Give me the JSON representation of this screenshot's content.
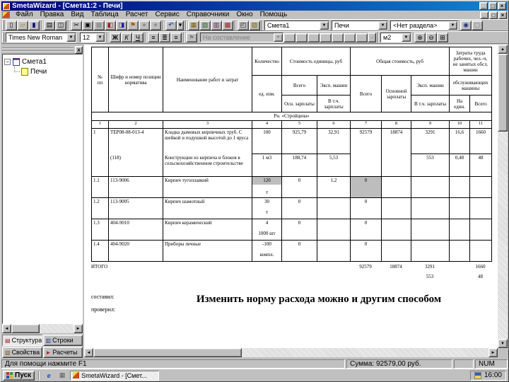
{
  "window": {
    "title": "SmetaWizard - [Смета1:2 - Печи]",
    "minimize": "_",
    "maximize": "□",
    "close": "×"
  },
  "menu": {
    "items": [
      "Файл",
      "Правка",
      "Вид",
      "Таблица",
      "Расчет",
      "Сервис",
      "Справочники",
      "Окно",
      "Помощь"
    ]
  },
  "icons": {
    "new": "▯",
    "open": "▱",
    "save": "▮",
    "print": "▤",
    "preview": "◫",
    "cut": "✂",
    "copy": "▣",
    "paste": "▩",
    "insert": "◧",
    "paste_special": "◨",
    "flag": "⚑",
    "wizard": "∗",
    "magic": "∗",
    "undo": "↶",
    "dropdown": "▾",
    "table": "▦",
    "edit_table": "▧",
    "add_table": "▥",
    "grid": "▩",
    "cell": "▨",
    "properties": "◰",
    "window": "▢",
    "find": "◉",
    "bold": "Ж",
    "italic": "К",
    "underline": "Ч",
    "align_left": "≡",
    "align_center": "≣",
    "align_right": "≡",
    "zoom_in": "⊕",
    "zoom_out": "⊖",
    "zoom_page": "⊞",
    "up": "▲",
    "down": "▼",
    "left": "◄",
    "right": "►",
    "minus": "−",
    "more": "▫",
    "ie": "e",
    "desktop": "▦",
    "tab_structure": "▤",
    "tab_rows": "▥",
    "tab_props": "▧",
    "tab_calc": "►"
  },
  "toolbar1": {
    "smeta_combo": "Смета1",
    "doc_combo": "Печи",
    "razdel_combo": "<Нет раздела>"
  },
  "toolbar2": {
    "font": "Times New Roman",
    "font_size": "12",
    "formula_combo": "На составление",
    "unit_combo": "м2"
  },
  "sidebar": {
    "root": "Смета1",
    "child": "Печи",
    "close": "x",
    "tabs": [
      "Структура",
      "Строки",
      "Свойства",
      "Расчеты"
    ]
  },
  "statusbar": {
    "help": "Для помощи нажмите F1",
    "sum": "Сумма: 92579,00 руб.",
    "num": "NUM"
  },
  "taskbar": {
    "start": "Пуск",
    "task": "SmetaWizard - [Смет...",
    "clock": "16:00"
  },
  "document": {
    "section_title": "Рн. «Стройцена»",
    "header": {
      "c1": "№\nпп",
      "c2": "Шифр и номер позиции норматива",
      "c3": "Наименование работ и затрат",
      "c4": "Количество",
      "c4_sub": "ед. изм.",
      "g_unit_cost": "Стоимость единицы, руб",
      "g_total_cost": "Общая стоимость, руб",
      "g_labor": "Затраты труда рабочих, чел.-ч, не занятых обсл. машин",
      "b5": "Всего",
      "b6": "Эксп. машин",
      "b7": "Всего",
      "b8": "Основной зарплаты",
      "b9": "Эксп. машин",
      "b_serv": "обслуживающих машины",
      "s5": "Осн. зарплаты",
      "s6": "В т.ч. зарплаты",
      "s9": "В т.ч. зарплаты",
      "s10": "На един.",
      "s11": "Всего",
      "numbers": [
        "1",
        "2",
        "3",
        "4",
        "5",
        "6",
        "7",
        "8",
        "9",
        "10",
        "11"
      ]
    },
    "rows": [
      {
        "num": "1",
        "code": "ТЕР08-08-013-4",
        "name": "Кладка дымовых кирпичных труб. С шейкой и подушкой высотой до 1 яруса",
        "qty": "100",
        "unit": "",
        "v5": "925,79",
        "v6": "32,91",
        "v7": "92579",
        "v8": "18874",
        "v9": "3291",
        "v10": "16,6",
        "v11": "1660",
        "style": "main"
      },
      {
        "num": "",
        "code": "(118)",
        "name": "Конструкции из кирпича и блоков в сельскохозяйственном строительстве",
        "qty": "1 м3",
        "unit": "",
        "v5": "188,74",
        "v6": "5,53",
        "v7": "",
        "v8": "",
        "v9": "553",
        "v10": "0,48",
        "v11": "48",
        "style": "sub"
      },
      {
        "num": "1.1",
        "code": "113-9006",
        "name": "Кирпич тугоплавкий",
        "qty": "120",
        "unit": "т",
        "v5": "0",
        "v6": "1,2",
        "v7": "0",
        "v8": "",
        "v9": "",
        "v10": "",
        "v11": "",
        "style": "res",
        "gray_qty": true,
        "gray_v7": true
      },
      {
        "num": "1.2",
        "code": "113-9005",
        "name": "Кирпич шамотный",
        "qty": "30",
        "unit": "т",
        "v5": "0",
        "v6": "",
        "v7": "0",
        "v8": "",
        "v9": "",
        "v10": "",
        "v11": "",
        "style": "res"
      },
      {
        "num": "1.3",
        "code": "404-9010",
        "name": "Кирпич керамический",
        "qty": "4",
        "unit": "1000 шт",
        "v5": "0",
        "v6": "",
        "v7": "0",
        "v8": "",
        "v9": "",
        "v10": "",
        "v11": "",
        "style": "res"
      },
      {
        "num": "1.4",
        "code": "404-9020",
        "name": "Приборы печные",
        "qty": "-100",
        "unit": "компл.",
        "v5": "0",
        "v6": "",
        "v7": "0",
        "v8": "",
        "v9": "",
        "v10": "",
        "v11": "",
        "style": "res"
      }
    ],
    "itogo": {
      "label": "ИТОГО",
      "v7": "92579",
      "v8": "18874",
      "v9": "3291",
      "v11": "1660",
      "v9_sub": "553",
      "v11_sub": "48"
    },
    "footer": {
      "left1": "составил:",
      "left2": "проверил:",
      "caption": "Изменить норму расхода можно и другим способом"
    }
  }
}
